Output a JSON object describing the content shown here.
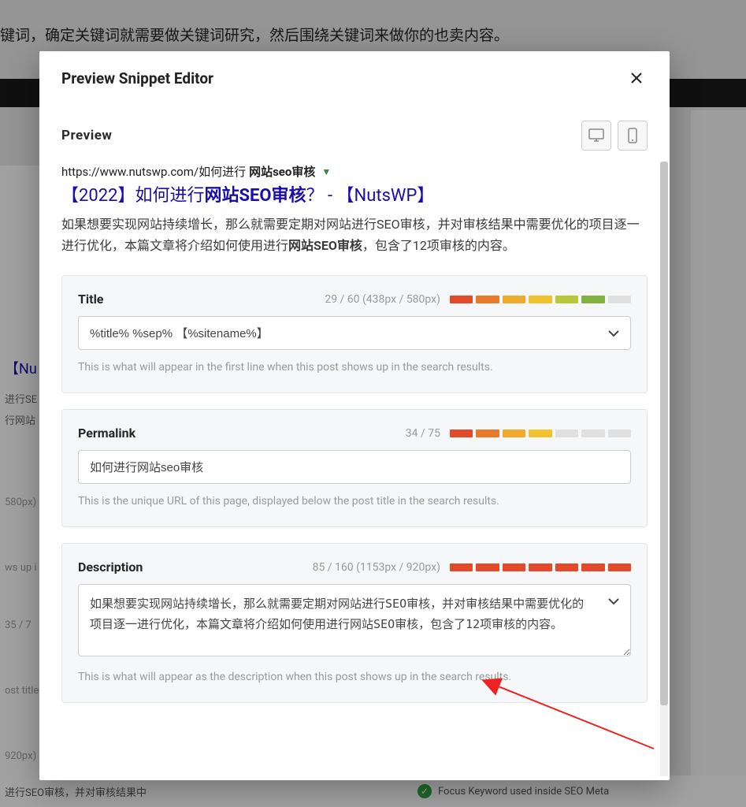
{
  "background": {
    "top_text": "键词，确定关键词就需要做关键词研究，然后围绕关键词来做你的也卖内容。",
    "left_fragments": [
      "【Nu",
      "进行SE",
      "行网站",
      "580px)",
      "ws up i",
      "35 / 7",
      "ost title",
      "920px)"
    ],
    "bottom_left": "进行SEO审核，并对审核结果中",
    "bottom_right": "Focus Keyword used inside SEO Meta"
  },
  "modal": {
    "title": "Preview Snippet Editor",
    "preview_label": "Preview",
    "url_prefix": "https://www.nutswp.com/如何进行",
    "url_bold": "网站seo审核",
    "title_prefix": "【2022】如何进行",
    "title_bold": "网站SEO审核",
    "title_suffix": "？ - 【NutsWP】",
    "desc_p1": "如果想要实现网站持续增长，那么就需要定期对网站进行SEO审核，并对审核结果中需要优化的项目逐一进行优化，本篇文章将介绍如何使用进行",
    "desc_bold": "网站SEO审核",
    "desc_p2": "，包含了12项审核的内容。",
    "fields": {
      "title": {
        "label": "Title",
        "count": "29 / 60 (438px / 580px)",
        "value": "%title% %sep% 【%sitename%】",
        "help": "This is what will appear in the first line when this post shows up in the search results.",
        "bars": [
          "#e24a2a",
          "#ea7a2a",
          "#f1a92c",
          "#f2c22f",
          "#b7c83a",
          "#7fb241",
          "#e0e0e0"
        ]
      },
      "permalink": {
        "label": "Permalink",
        "count": "34 / 75",
        "value": "如何进行网站seo审核",
        "help": "This is the unique URL of this page, displayed below the post title in the search results.",
        "bars": [
          "#e24a2a",
          "#ea7a2a",
          "#f1a92c",
          "#f2c22f",
          "#e0e0e0",
          "#e0e0e0",
          "#e0e0e0"
        ]
      },
      "description": {
        "label": "Description",
        "count": "85 / 160 (1153px / 920px)",
        "value": "如果想要实现网站持续增长，那么就需要定期对网站进行SEO审核，并对审核结果中需要优化的项目逐一进行优化，本篇文章将介绍如何使用进行网站SEO审核，包含了12项审核的内容。",
        "help": "This is what will appear as the description when this post shows up in the search results.",
        "bars": [
          "#e24a2a",
          "#e24a2a",
          "#e24a2a",
          "#e24a2a",
          "#e24a2a",
          "#e24a2a",
          "#e24a2a"
        ]
      }
    }
  }
}
